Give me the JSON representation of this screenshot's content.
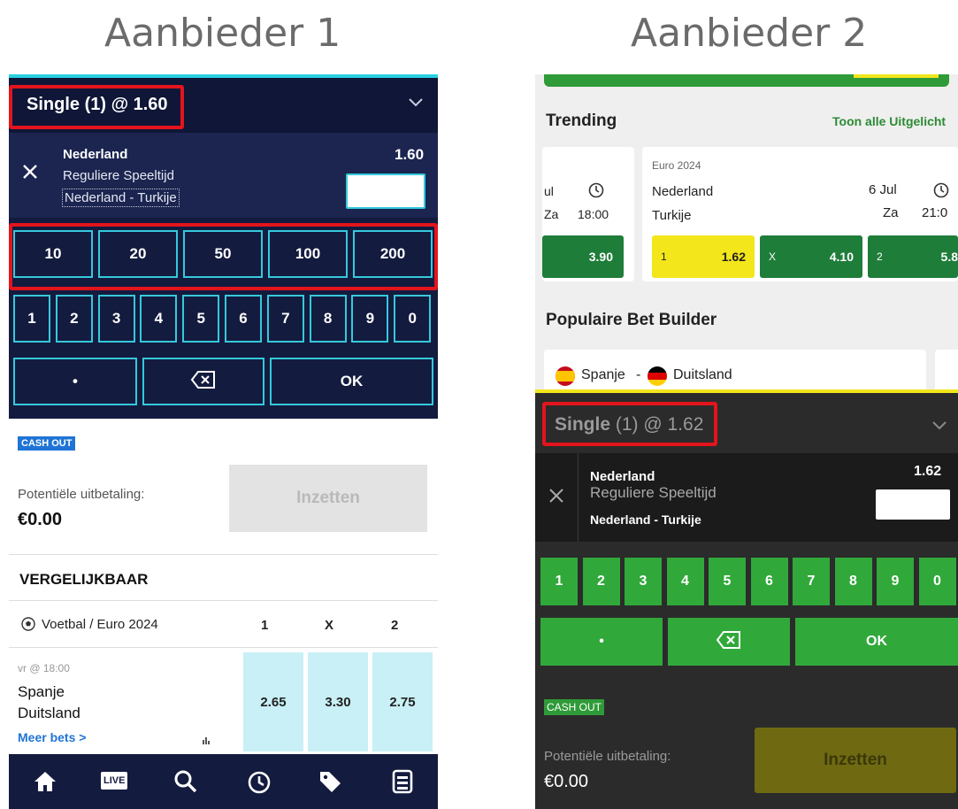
{
  "headings": {
    "left": "Aanbieder 1",
    "right": "Aanbieder 2"
  },
  "left": {
    "slip_title": "Single (1) @ 1.60",
    "selection": {
      "team": "Nederland",
      "market": "Reguliere Speeltijd",
      "match": "Nederland - Turkije",
      "odds": "1.60"
    },
    "quick_stakes": [
      "10",
      "20",
      "50",
      "100",
      "200"
    ],
    "keypad_digits": [
      "1",
      "2",
      "3",
      "4",
      "5",
      "6",
      "7",
      "8",
      "9",
      "0"
    ],
    "keypad_dot": "•",
    "keypad_ok": "OK",
    "cash_out": "CASH OUT",
    "payout_label": "Potentiële uitbetaling:",
    "payout_value": "€0.00",
    "stake_button": "Inzetten",
    "section_title": "VERGELIJKBAAR",
    "compare": {
      "league": "Voetbal / Euro 2024",
      "cols": [
        "1",
        "X",
        "2"
      ],
      "time": "vr @ 18:00",
      "home": "Spanje",
      "away": "Duitsland",
      "more": "Meer bets >",
      "odds": [
        "2.65",
        "3.30",
        "2.75"
      ]
    },
    "nav": [
      "home-icon",
      "live-icon",
      "search-icon",
      "clock-icon",
      "tag-icon",
      "betslip-icon"
    ],
    "nav_live": "LIVE",
    "colors": {
      "navy": "#131b3f",
      "accent": "#35c9dc",
      "highlight": "#e3141c"
    }
  },
  "right": {
    "trending_title": "Trending",
    "trending_link": "Toon alle Uitgelicht",
    "left_card": {
      "team1": "ul",
      "team2": "Za",
      "time": "18:00",
      "odds": "3.90"
    },
    "main_card": {
      "league": "Euro 2024",
      "home": "Nederland",
      "away": "Turkije",
      "date": "6 Jul",
      "day": "Za",
      "time": "21:0",
      "odds": [
        {
          "label": "1",
          "value": "1.62"
        },
        {
          "label": "X",
          "value": "4.10"
        },
        {
          "label": "2",
          "value": "5.8"
        }
      ]
    },
    "builder_title": "Populaire Bet Builder",
    "builder_match": {
      "home": "Spanje",
      "sep": "-",
      "away": "Duitsland"
    },
    "slip_title_bold": "Single",
    "slip_title_rest": " (1) @ 1.62",
    "selection": {
      "team": "Nederland",
      "market": "Reguliere Speeltijd",
      "match": "Nederland - Turkije",
      "odds": "1.62"
    },
    "keypad_digits": [
      "1",
      "2",
      "3",
      "4",
      "5",
      "6",
      "7",
      "8",
      "9",
      "0"
    ],
    "keypad_dot": "•",
    "keypad_ok": "OK",
    "cash_out": "CASH OUT",
    "payout_label": "Potentiële uitbetaling:",
    "payout_value": "€0.00",
    "stake_button": "Inzetten",
    "colors": {
      "green": "#31a83a",
      "yellow": "#f3e61b",
      "dark": "#2c2c2c",
      "stake": "#6f6a12"
    }
  }
}
